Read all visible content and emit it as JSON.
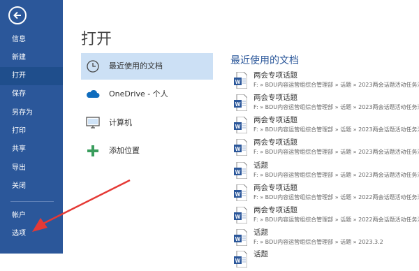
{
  "sidebar": {
    "items": [
      {
        "label": "信息"
      },
      {
        "label": "新建"
      },
      {
        "label": "打开"
      },
      {
        "label": "保存"
      },
      {
        "label": "另存为"
      },
      {
        "label": "打印"
      },
      {
        "label": "共享"
      },
      {
        "label": "导出"
      },
      {
        "label": "关闭"
      },
      {
        "label": "帐户"
      },
      {
        "label": "选项"
      }
    ],
    "active": "打开"
  },
  "main": {
    "title": "打开",
    "locations": [
      {
        "label": "最近使用的文档",
        "icon": "clock-icon"
      },
      {
        "label": "OneDrive - 个人",
        "icon": "cloud-icon"
      },
      {
        "label": "计算机",
        "icon": "computer-icon"
      },
      {
        "label": "添加位置",
        "icon": "plus-icon"
      }
    ],
    "recent_title": "最近使用的文档",
    "recent": [
      {
        "name": "两会专项话题",
        "path": "F: » BDU内容运营组综合管理部 » 话题 » 2023两会话题活动任务汇"
      },
      {
        "name": "两会专项话题",
        "path": "F: » BDU内容运营组综合管理部 » 话题 » 2023两会话题活动任务汇"
      },
      {
        "name": "两会专项话题",
        "path": "F: » BDU内容运营组综合管理部 » 话题 » 2023两会话题活动任务汇"
      },
      {
        "name": "两会专项话题",
        "path": "F: » BDU内容运营组综合管理部 » 话题 » 2023两会话题活动任务汇"
      },
      {
        "name": "话题",
        "path": "F: » BDU内容运营组综合管理部 » 话题 » 2023两会话题活动任务汇"
      },
      {
        "name": "两会专项话题",
        "path": "F: » BDU内容运营组综合管理部 » 话题 » 2022两会话题活动任务汇"
      },
      {
        "name": "两会专项话题",
        "path": "F: » BDU内容运营组综合管理部 » 话题 » 2022两会话题活动任务汇"
      },
      {
        "name": "话题",
        "path": "F: » BDU内容运营组综合管理部 » 话题 » 2023.3.2"
      },
      {
        "name": "话题",
        "path": ""
      }
    ]
  },
  "colors": {
    "sidebar": "#2b579a",
    "active_nav": "#1f4e8c",
    "selected_location": "#cce0f5",
    "word_icon": "#2b579a",
    "annotation_arrow": "#e53935"
  }
}
